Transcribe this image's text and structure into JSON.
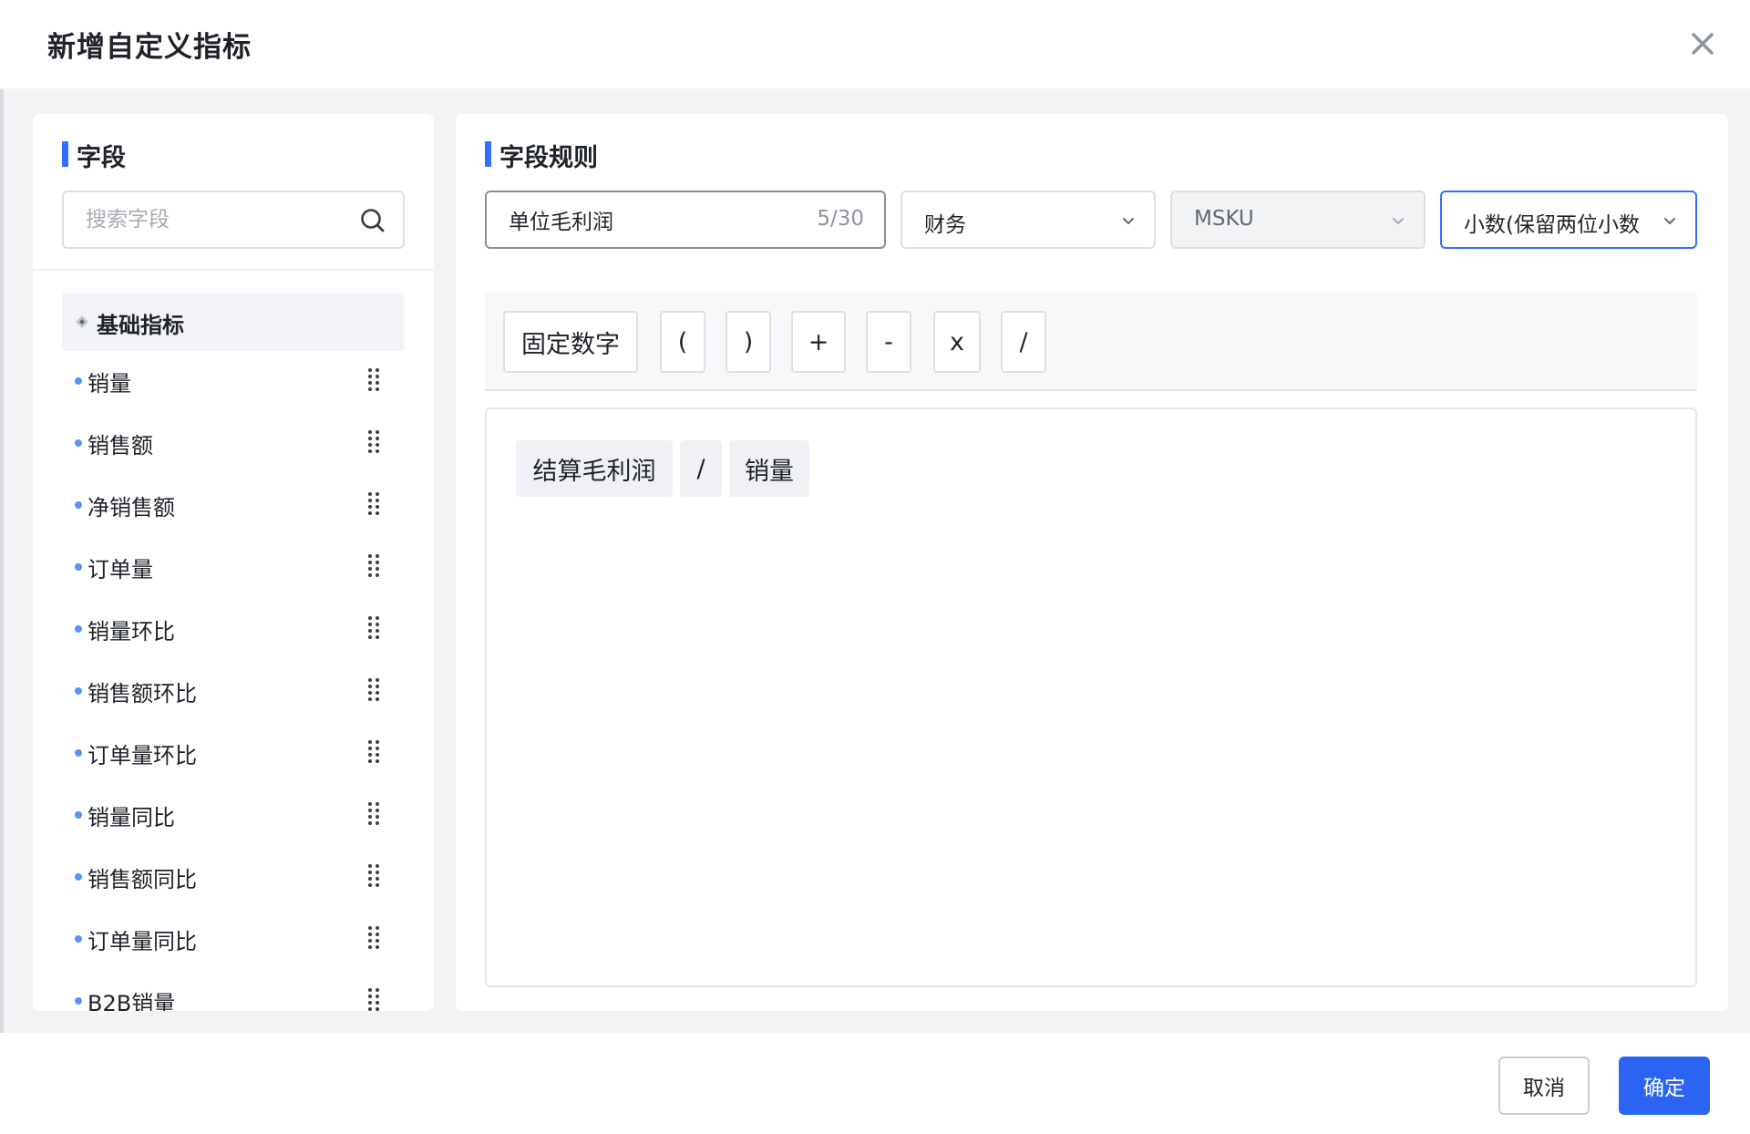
{
  "modal": {
    "title": "新增自定义指标"
  },
  "fields_panel": {
    "title": "字段",
    "search_placeholder": "搜索字段",
    "group": {
      "label": "基础指标"
    },
    "items": [
      {
        "label": "销量"
      },
      {
        "label": "销售额"
      },
      {
        "label": "净销售额"
      },
      {
        "label": "订单量"
      },
      {
        "label": "销量环比"
      },
      {
        "label": "销售额环比"
      },
      {
        "label": "订单量环比"
      },
      {
        "label": "销量同比"
      },
      {
        "label": "销售额同比"
      },
      {
        "label": "订单量同比"
      },
      {
        "label": "B2B销量"
      }
    ]
  },
  "rules_panel": {
    "title": "字段规则",
    "name_input": {
      "value": "单位毛利润",
      "count": "5/30"
    },
    "selects": [
      {
        "value": "财务",
        "disabled": false
      },
      {
        "value": "MSKU",
        "disabled": true
      },
      {
        "value": "小数(保留两位小数",
        "disabled": false
      }
    ],
    "operators": [
      {
        "label": "固定数字"
      },
      {
        "label": "("
      },
      {
        "label": ")"
      },
      {
        "label": "+"
      },
      {
        "label": "-"
      },
      {
        "label": "x"
      },
      {
        "label": "/"
      }
    ],
    "formula_tokens": [
      {
        "label": "结算毛利润"
      },
      {
        "label": "/"
      },
      {
        "label": "销量"
      }
    ]
  },
  "footer": {
    "cancel_label": "取消",
    "ok_label": "确定"
  },
  "colors": {
    "accent": "#3370ff",
    "primary_button": "#2b63f2",
    "field_dot": "#5b8ff9"
  }
}
